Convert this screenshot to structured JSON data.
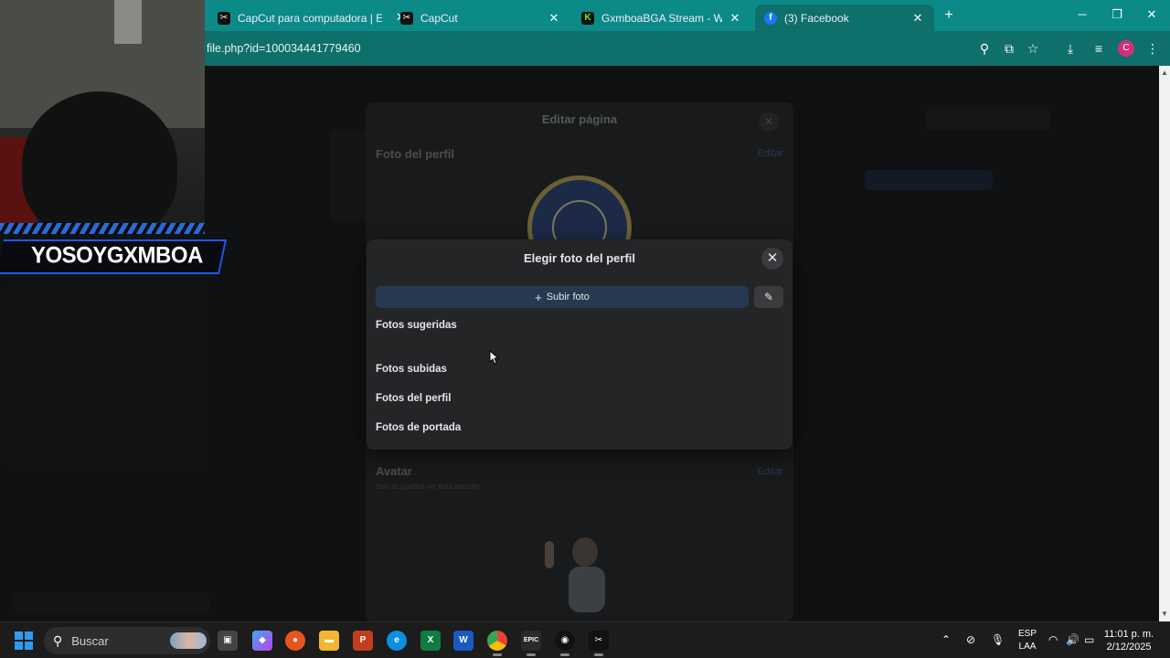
{
  "browser": {
    "tabs": [
      {
        "label": "CapCut para computadora | El e",
        "favicon": "capcut-icon"
      },
      {
        "label": "CapCut",
        "favicon": "capcut-icon"
      },
      {
        "label": "GxmboaBGA Stream - Watch Li",
        "favicon": "kick-icon"
      },
      {
        "label": "(3) Facebook",
        "favicon": "facebook-icon",
        "active": true
      }
    ],
    "url": "file.php?id=100034441779460",
    "accent": "#0b8a87",
    "profile_initial": "C"
  },
  "edit_page": {
    "title": "Editar página",
    "profile_photo_heading": "Foto del perfil",
    "edit_link": "Editar",
    "avatar_heading": "Avatar",
    "avatar_note": "Solo tú puedes ver esta sección",
    "avatar_edit_link": "Editar"
  },
  "stream_overlay": {
    "name": "YOSOYGXMBOA"
  },
  "chooser": {
    "title": "Elegir foto del perfil",
    "upload_label": "Subir foto",
    "sections": [
      "Fotos sugeridas",
      "Fotos subidas",
      "Fotos del perfil",
      "Fotos de portada"
    ]
  },
  "taskbar": {
    "search_placeholder": "Buscar",
    "lang_line1": "ESP",
    "lang_line2": "LAA",
    "time": "11:01 p. m.",
    "date": "2/12/2025"
  }
}
